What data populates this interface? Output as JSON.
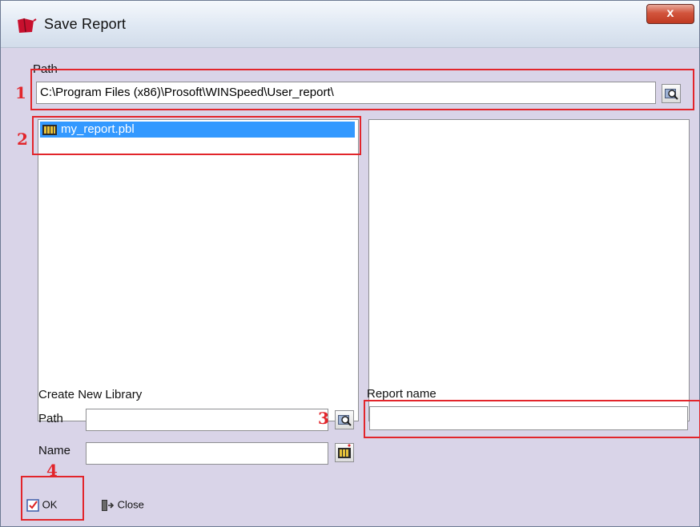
{
  "window": {
    "title": "Save Report",
    "close_label": "x"
  },
  "path_section": {
    "label": "Path",
    "value": "C:\\Program Files (x86)\\Prosoft\\WINSpeed\\User_report\\"
  },
  "library_list": {
    "items": [
      {
        "name": "my_report.pbl",
        "selected": true
      }
    ]
  },
  "create_new_library": {
    "label": "Create New Library",
    "path_label": "Path",
    "path_value": "",
    "name_label": "Name",
    "name_value": ""
  },
  "report_name": {
    "label": "Report name",
    "value": ""
  },
  "buttons": {
    "ok_label": "OK",
    "close_label": "Close"
  },
  "annotations": {
    "marker_1": "1",
    "marker_2": "2",
    "marker_3": "3",
    "marker_4": "4",
    "color": "#e2252b"
  },
  "colors": {
    "dialog_bg": "#d9d4e8",
    "selection": "#3399ff"
  }
}
